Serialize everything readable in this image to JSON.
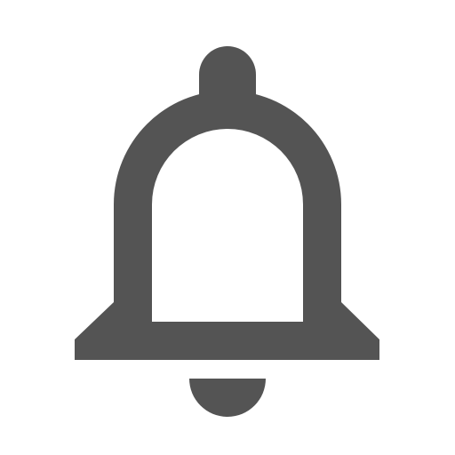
{
  "icon": {
    "name": "bell-icon",
    "semantic": "notifications",
    "color": "#545454",
    "background": "#ffffff"
  }
}
